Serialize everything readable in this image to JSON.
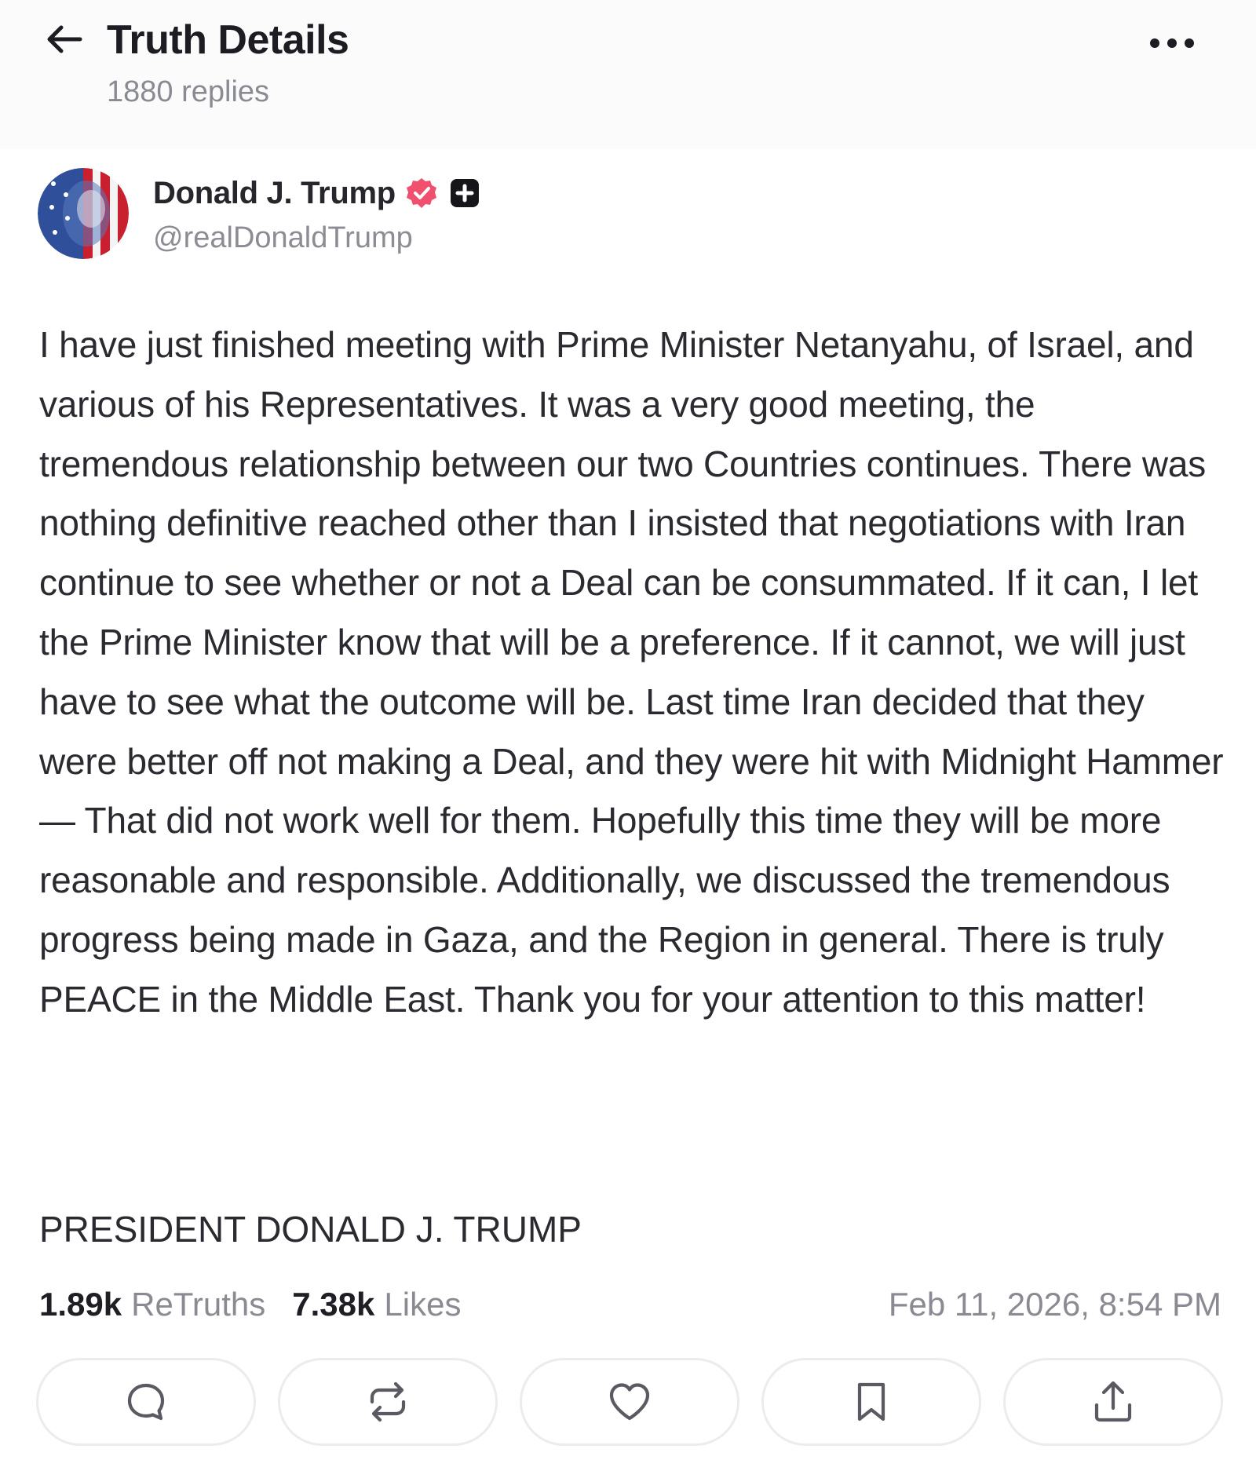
{
  "header": {
    "title": "Truth Details",
    "replies": "1880 replies",
    "back_icon": "arrow-left-icon",
    "more_icon": "more-horizontal-icon"
  },
  "author": {
    "name": "Donald J. Trump",
    "handle": "@realDonaldTrump",
    "verified_icon": "verified-badge-icon",
    "verified_color": "#f0506e",
    "plus_icon": "plus-badge-icon"
  },
  "post": {
    "body": "I have just finished meeting with Prime Minister Netanyahu, of Israel, and various of his Representatives. It was a very good meeting, the tremendous relationship between our two Countries continues. There was nothing definitive reached other than I insisted that negotiations with Iran continue to see whether or not a Deal can be consummated. If it can, I let the Prime Minister know that will be a preference. If it cannot, we will just have to see what the outcome will be. Last time Iran decided that they were better off not making a Deal, and they were hit with Midnight Hammer — That did not work well for them. Hopefully this time they will be more reasonable and responsible. Additionally, we discussed the tremendous progress being made in Gaza, and the Region in general. There is truly PEACE in the Middle East. Thank you for your attention to this matter!",
    "signature": "PRESIDENT DONALD J. TRUMP"
  },
  "stats": {
    "retruths_count": "1.89k",
    "retruths_label": "ReTruths",
    "likes_count": "7.38k",
    "likes_label": "Likes",
    "timestamp": "Feb 11, 2026, 8:54 PM"
  },
  "actions": [
    {
      "name": "reply",
      "icon": "reply-icon"
    },
    {
      "name": "retruth",
      "icon": "retruth-icon"
    },
    {
      "name": "like",
      "icon": "heart-icon"
    },
    {
      "name": "bookmark",
      "icon": "bookmark-icon"
    },
    {
      "name": "share",
      "icon": "share-icon"
    }
  ]
}
